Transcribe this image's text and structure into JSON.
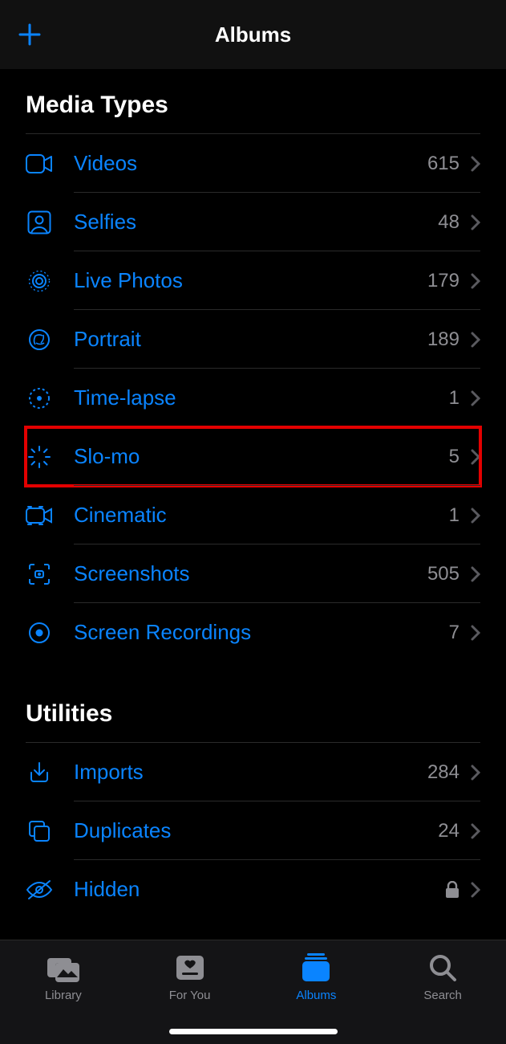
{
  "header": {
    "title": "Albums"
  },
  "sections": {
    "media_types": {
      "title": "Media Types",
      "items": [
        {
          "label": "Videos",
          "count": "615"
        },
        {
          "label": "Selfies",
          "count": "48"
        },
        {
          "label": "Live Photos",
          "count": "179"
        },
        {
          "label": "Portrait",
          "count": "189"
        },
        {
          "label": "Time-lapse",
          "count": "1"
        },
        {
          "label": "Slo-mo",
          "count": "5"
        },
        {
          "label": "Cinematic",
          "count": "1"
        },
        {
          "label": "Screenshots",
          "count": "505"
        },
        {
          "label": "Screen Recordings",
          "count": "7"
        }
      ]
    },
    "utilities": {
      "title": "Utilities",
      "items": [
        {
          "label": "Imports",
          "count": "284"
        },
        {
          "label": "Duplicates",
          "count": "24"
        },
        {
          "label": "Hidden",
          "locked": true
        }
      ]
    }
  },
  "tabs": [
    {
      "label": "Library"
    },
    {
      "label": "For You"
    },
    {
      "label": "Albums"
    },
    {
      "label": "Search"
    }
  ]
}
